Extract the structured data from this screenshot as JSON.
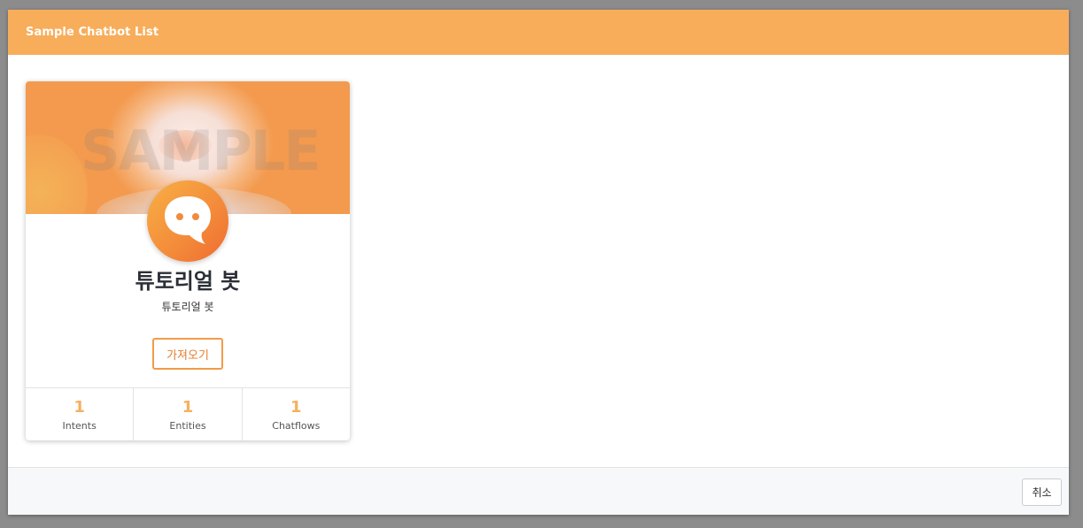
{
  "modal": {
    "title": "Sample Chatbot List"
  },
  "card": {
    "banner_watermark": "SAMPLE",
    "bot_name": "튜토리얼 봇",
    "bot_description": "튜토리얼 봇",
    "import_label": "가져오기",
    "avatar_icon": "chat-bubble-icon",
    "stats": [
      {
        "value": "1",
        "label": "Intents"
      },
      {
        "value": "1",
        "label": "Entities"
      },
      {
        "value": "1",
        "label": "Chatflows"
      }
    ]
  },
  "footer": {
    "cancel_label": "취소"
  },
  "colors": {
    "header": "#f8ad5b",
    "accent": "#f39a4a",
    "stat_value": "#f6b060"
  }
}
